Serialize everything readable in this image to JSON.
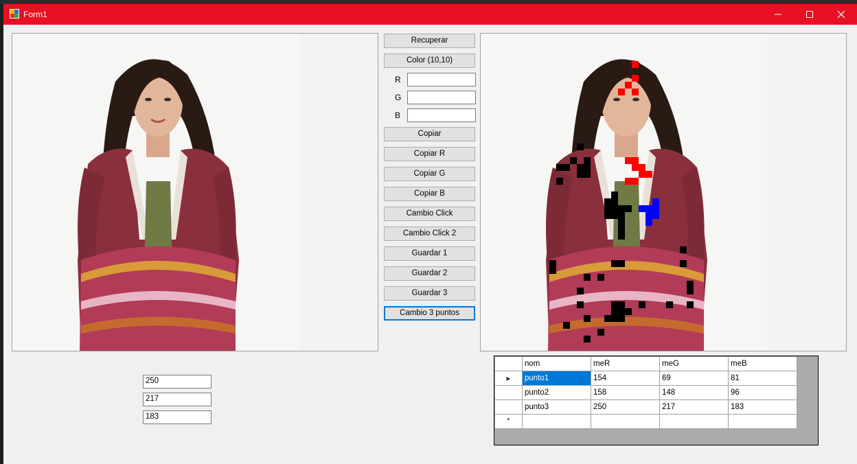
{
  "window": {
    "title": "Form1"
  },
  "buttons": {
    "recuperar": "Recuperar",
    "color": "Color (10,10)",
    "copiar": "Copiar",
    "copiar_r": "Copiar R",
    "copiar_g": "Copiar G",
    "copiar_b": "Copiar B",
    "cambio_click": "Cambio Click",
    "cambio_click_2": "Cambio Click 2",
    "guardar_1": "Guardar 1",
    "guardar_2": "Guardar 2",
    "guardar_3": "Guardar 3",
    "cambio_3_puntos": "Cambio 3 puntos"
  },
  "rgb_fields": {
    "r_label": "R",
    "g_label": "G",
    "b_label": "B",
    "r_value": "",
    "g_value": "",
    "b_value": ""
  },
  "lower_fields": [
    "250",
    "217",
    "183"
  ],
  "table": {
    "columns": [
      "nom",
      "meR",
      "meG",
      "meB"
    ],
    "rows": [
      [
        "punto1",
        "154",
        "69",
        "81"
      ],
      [
        "punto2",
        "158",
        "148",
        "96"
      ],
      [
        "punto3",
        "250",
        "217",
        "183"
      ]
    ],
    "selected_row_marker": "▶",
    "new_row_marker": "*"
  },
  "colors": {
    "titlebar": "#e81123",
    "selection": "#0078d7",
    "marker_red": "#ff0000",
    "marker_blue": "#0000ff",
    "marker_black": "#000000"
  },
  "icons": [
    "app-icon",
    "minimize-icon",
    "maximize-icon",
    "close-icon"
  ]
}
